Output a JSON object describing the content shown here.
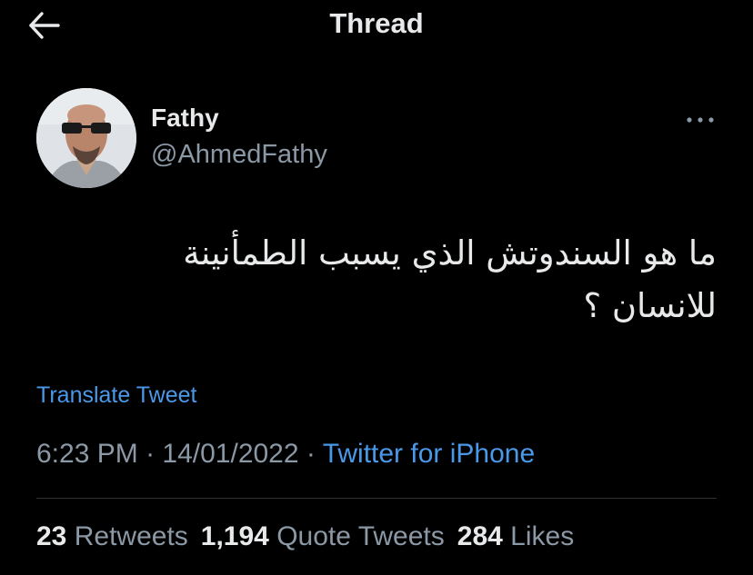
{
  "header": {
    "back_icon": "arrow-left-icon",
    "title": "Thread"
  },
  "author": {
    "display_name": "Fathy",
    "handle": "@AhmedFathy",
    "more_icon": "more-horizontal-icon"
  },
  "tweet": {
    "text_line1": "ما هو السندوتش الذي يسبب الطمأنينة",
    "text_line2": "للانسان ؟",
    "translate_label": "Translate Tweet",
    "time": "6:23 PM",
    "separator": " · ",
    "date": "14/01/2022",
    "source": "Twitter for iPhone"
  },
  "stats": {
    "retweets_count": "23",
    "retweets_label": "Retweets",
    "quote_count": "1,194",
    "quote_label": "Quote Tweets",
    "likes_count": "284",
    "likes_label": "Likes"
  },
  "colors": {
    "background": "#000000",
    "text_primary": "#e7e9ea",
    "text_secondary": "#8b98a5",
    "link": "#4a99e9",
    "divider": "#2f3336"
  }
}
